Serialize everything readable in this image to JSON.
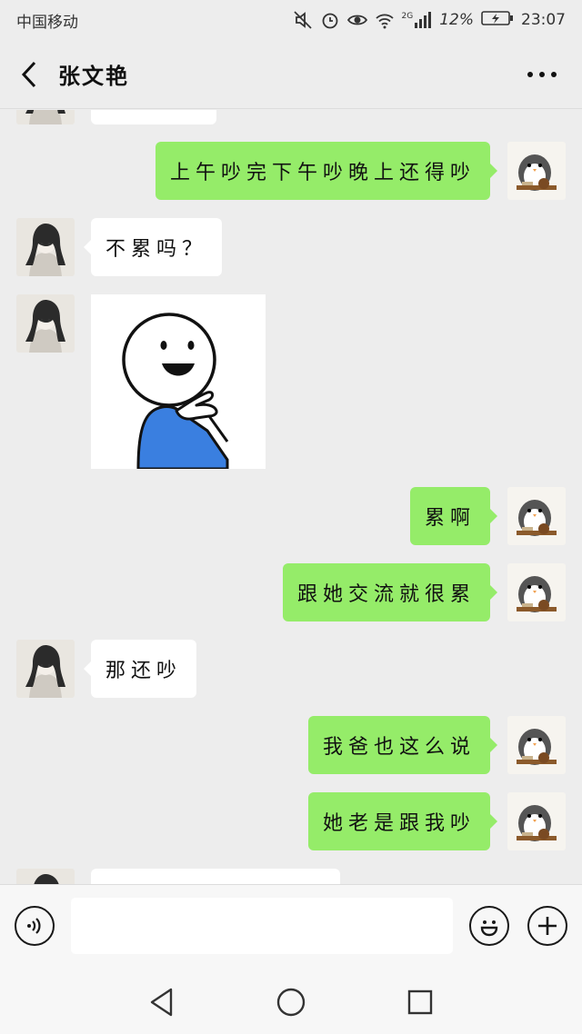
{
  "status_bar": {
    "carrier": "中国移动",
    "network": "2G",
    "battery": "12%",
    "time": "23:07"
  },
  "header": {
    "title": "张文艳"
  },
  "messages": [
    {
      "side": "in",
      "type": "text",
      "text": "",
      "partial": true
    },
    {
      "side": "out",
      "type": "text",
      "text": "上午吵完下午吵晚上还得吵"
    },
    {
      "side": "in",
      "type": "text",
      "text": "不累吗？"
    },
    {
      "side": "in",
      "type": "sticker",
      "icon": "thinking-stickman-sticker"
    },
    {
      "side": "out",
      "type": "text",
      "text": "累啊"
    },
    {
      "side": "out",
      "type": "text",
      "text": "跟她交流就很累"
    },
    {
      "side": "in",
      "type": "text",
      "text": "那还吵"
    },
    {
      "side": "out",
      "type": "text",
      "text": "我爸也这么说"
    },
    {
      "side": "out",
      "type": "text",
      "text": "她老是跟我吵"
    },
    {
      "side": "in",
      "type": "text",
      "text": "",
      "partial": true
    }
  ],
  "input_bar": {
    "voice_icon": "voice-icon",
    "emoji_icon": "emoji-icon",
    "plus_icon": "plus-icon",
    "value": ""
  },
  "colors": {
    "outgoing_bubble": "#95ec69",
    "incoming_bubble": "#ffffff",
    "background": "#ededed"
  }
}
